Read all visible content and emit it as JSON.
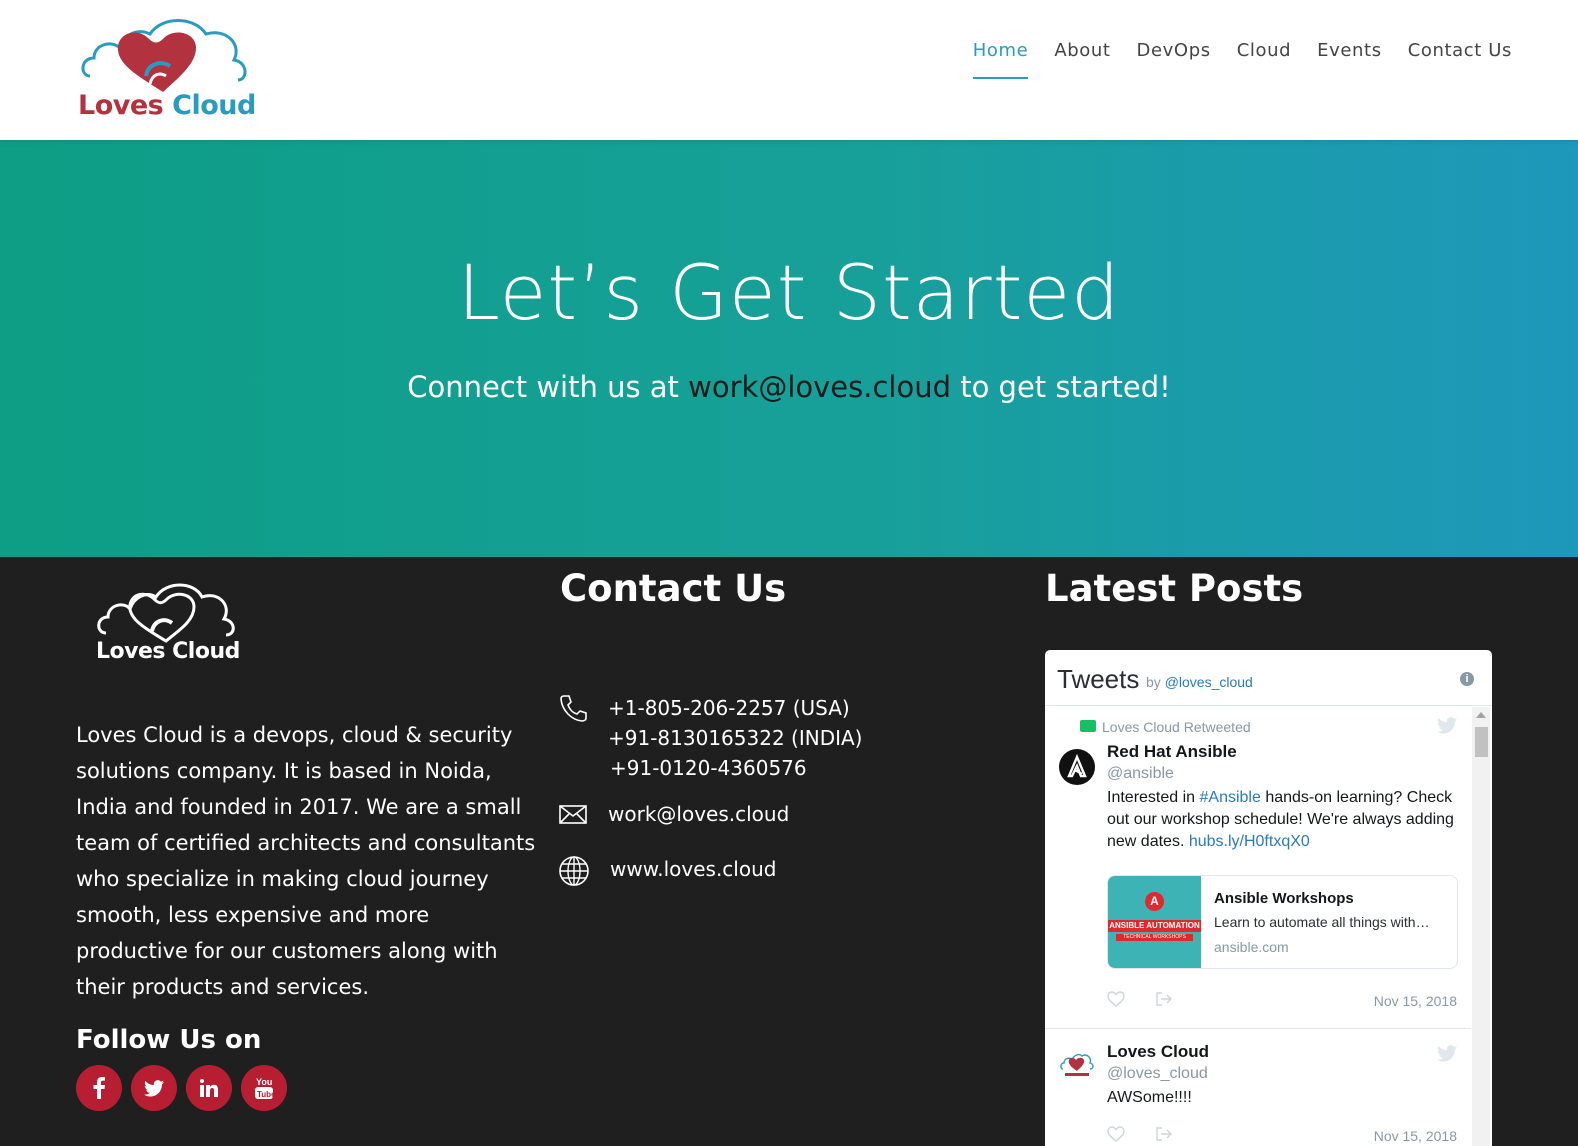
{
  "header": {
    "logo": {
      "word1": "Loves",
      "word2": "Cloud"
    },
    "nav": [
      {
        "label": "Home",
        "active": true
      },
      {
        "label": "About"
      },
      {
        "label": "DevOps"
      },
      {
        "label": "Cloud"
      },
      {
        "label": "Events"
      },
      {
        "label": "Contact Us"
      }
    ]
  },
  "hero": {
    "title": "Let’s Get Started",
    "subtitle_pre": "Connect with us at ",
    "email": "work@loves.cloud",
    "subtitle_post": " to get started!",
    "colors": {
      "start": "#0d9e85",
      "end": "#1e98bb"
    }
  },
  "footer": {
    "logo_text": "Loves Cloud",
    "about": "Loves Cloud is a devops, cloud & security solutions company. It is based in Noida, India and founded in 2017. We are a small team of certified architects and consultants who specialize in making cloud journey smooth, less expensive and more productive for our customers along with their products and services.",
    "follow_title": "Follow Us on",
    "socials": [
      "facebook-icon",
      "twitter-icon",
      "linkedin-icon",
      "youtube-icon"
    ],
    "social_color": "#b81e32",
    "contact": {
      "title": "Contact Us",
      "phones": [
        "+1-805-206-2257 (USA)",
        "+91-8130165322 (INDIA)",
        "+91-0120-4360576"
      ],
      "email": "work@loves.cloud",
      "website": "www.loves.cloud"
    },
    "posts": {
      "title": "Latest Posts",
      "widget": {
        "title": "Tweets",
        "by": "by ",
        "account": "@loves_cloud",
        "tweets": [
          {
            "retweet_label": "Loves Cloud Retweeted",
            "name": "Red Hat Ansible",
            "handle": "@ansible",
            "text_pre": "Interested in ",
            "hashtag": "#Ansible",
            "text_mid": " hands-on learning? Check out our workshop schedule! We're always adding new dates. ",
            "link": "hubs.ly/H0ftxqX0",
            "card": {
              "image_band": "ANSIBLE AUTOMATION",
              "image_sub": "TECHNICAL WORKSHOPS",
              "title": "Ansible Workshops",
              "desc": "Learn to automate all things with…",
              "domain": "ansible.com"
            },
            "date": "Nov 15, 2018"
          },
          {
            "name": "Loves Cloud",
            "handle": "@loves_cloud",
            "text": "AWSome!!!!",
            "date": "Nov 15, 2018"
          }
        ]
      }
    }
  }
}
